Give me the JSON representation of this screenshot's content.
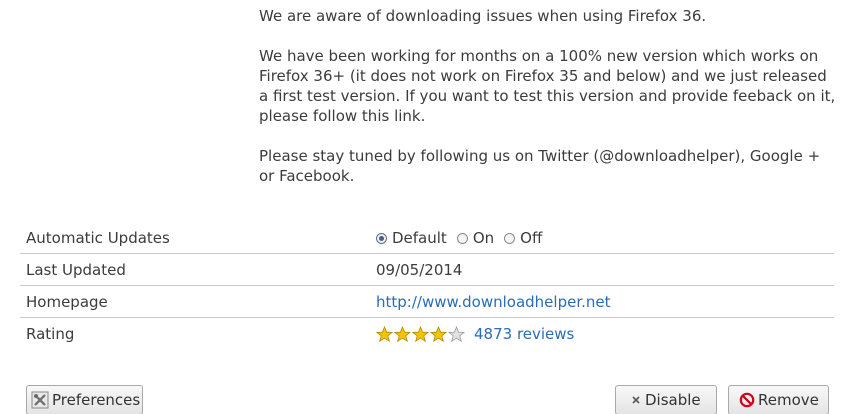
{
  "description": {
    "paragraphs": [
      "We are aware of downloading issues when using Firefox 36.",
      "We have been working for months on a 100% new version which works on Firefox 36+ (it does not work on Firefox 35 and below) and we just released a first test version. If you want to test this version and provide feeback on it, please follow this link.",
      "Please stay tuned by following us on Twitter (@downloadhelper), Google + or Facebook."
    ]
  },
  "details": {
    "automatic_updates": {
      "label": "Automatic Updates",
      "options": [
        "Default",
        "On",
        "Off"
      ],
      "selected": "Default"
    },
    "last_updated": {
      "label": "Last Updated",
      "value": "09/05/2014"
    },
    "homepage": {
      "label": "Homepage",
      "value": "http://www.downloadhelper.net"
    },
    "rating": {
      "label": "Rating",
      "stars": 4,
      "max_stars": 5,
      "reviews": "4873 reviews"
    }
  },
  "buttons": {
    "preferences": "Preferences",
    "disable": "Disable",
    "remove": "Remove"
  },
  "icons": {
    "preferences": "preferences-icon",
    "disable": "close-icon",
    "remove": "remove-icon"
  },
  "colors": {
    "link": "#2a6cb8",
    "star_filled": "#f5c400",
    "remove_icon": "#d0021b"
  }
}
